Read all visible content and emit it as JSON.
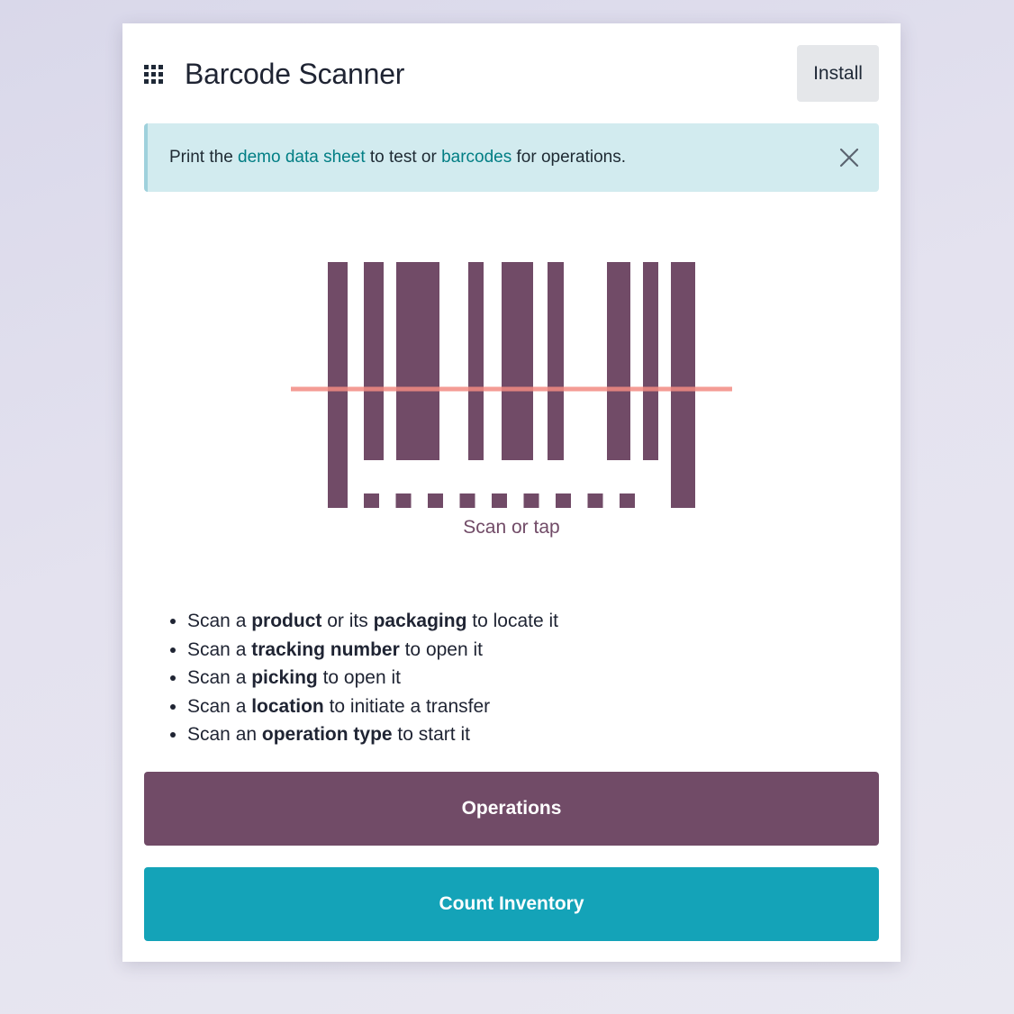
{
  "header": {
    "title": "Barcode Scanner",
    "install_label": "Install",
    "apps_icon": "apps-grid-icon"
  },
  "alert": {
    "text_before": "Print the ",
    "link1": "demo data sheet",
    "text_middle": " to test or ",
    "link2": "barcodes",
    "text_after": " for operations.",
    "close_icon": "close-icon"
  },
  "scanner": {
    "label": "Scan or tap",
    "bar_color": "#714b67",
    "laser_color": "#f28b82"
  },
  "tips": [
    {
      "pre": "Scan a ",
      "b1": "product",
      "mid": " or its ",
      "b2": "packaging",
      "post": " to locate it"
    },
    {
      "pre": "Scan a ",
      "b1": "tracking number",
      "mid": " to open it",
      "b2": "",
      "post": ""
    },
    {
      "pre": "Scan a ",
      "b1": "picking",
      "mid": " to open it",
      "b2": "",
      "post": ""
    },
    {
      "pre": "Scan a ",
      "b1": "location",
      "mid": " to initiate a transfer",
      "b2": "",
      "post": ""
    },
    {
      "pre": "Scan an ",
      "b1": "operation type",
      "mid": " to start it",
      "b2": "",
      "post": ""
    }
  ],
  "buttons": {
    "operations": "Operations",
    "count_inventory": "Count Inventory"
  },
  "colors": {
    "primary": "#714b67",
    "secondary": "#14a3b8",
    "link": "#017e84",
    "alert_bg": "#d2ebef"
  }
}
